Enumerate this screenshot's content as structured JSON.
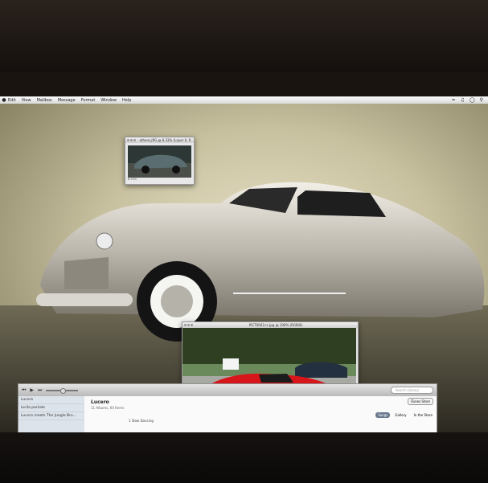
{
  "menubar": {
    "items": [
      "Edit",
      "View",
      "Mailbox",
      "Message",
      "Format",
      "Window",
      "Help"
    ]
  },
  "small_window": {
    "title": "athens.JPG @ 8.33% (Layer 0, R",
    "zoom": "8.33%"
  },
  "photo_window": {
    "title": "PICT0003.rc.jpg @ 100% (RGB/8)"
  },
  "itunes": {
    "search_placeholder": "Search Library",
    "sidebar": [
      "Lucero",
      "lucila pariiale",
      "Lucero meets The Jungle Bro..."
    ],
    "album_title": "Lucero",
    "album_meta": "11 Albums, 60 Items",
    "track": "1  Slow Dancing",
    "store_button": "iTunes Store",
    "tabs": [
      "Songs",
      "Gallery",
      "In the Store"
    ]
  },
  "colors": {
    "accent_car_red": "#d7161b",
    "car_body": "#cfcac0"
  }
}
